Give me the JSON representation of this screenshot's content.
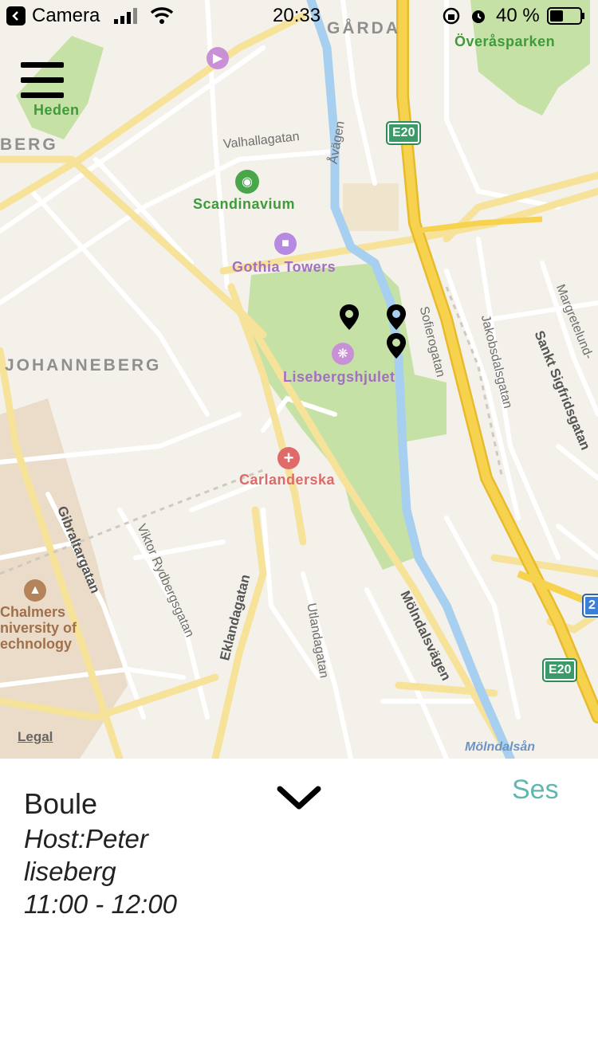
{
  "status_bar": {
    "back_app": "Camera",
    "time": "20:33",
    "battery": "40 %"
  },
  "map": {
    "districts": {
      "heden": "Heden",
      "berg": "BERG",
      "garda": "GÅRDA",
      "johanneberg": "JOHANNEBERG"
    },
    "streets": {
      "valhallagatan": "Valhallagatan",
      "avagen": "Åvägen",
      "sofierogatan": "Sofierogatan",
      "jakobsdalsgatan": "Jakobsdalsgatan",
      "margretelund": "Margretelund-",
      "sankt_sigfridsgatan": "Sankt Sigfridsgatan",
      "gibraltargatan": "Gibraltargatan",
      "viktor_rydbergsgatan": "Viktor Rydbergsgatan",
      "eklandagatan": "Eklandagatan",
      "utlandagatan": "Utlandagatan",
      "molndalsvagen": "Mölndalsvägen"
    },
    "pois": {
      "overasparken": "Överåsparken",
      "scandinavium": "Scandinavium",
      "gothia_towers": "Gothia Towers",
      "lisebergshjulet": "Lisebergshjulet",
      "carlanderska": "Carlanderska",
      "chalmers_1": "Chalmers",
      "chalmers_2": "niversity of",
      "chalmers_3": "echnology"
    },
    "water": {
      "molndalsan": "Mölndalsån"
    },
    "road_shields": [
      "E20",
      "E20",
      "2"
    ],
    "pins": 3,
    "legal": "Legal"
  },
  "sheet": {
    "title": "Boule",
    "host": "Host:Peter",
    "location": "liseberg",
    "time_range": "11:00 - 12:00",
    "action": "Ses"
  },
  "colors": {
    "map_bg": "#f4f1ea",
    "park": "#c5e1a5",
    "highway": "#f5d14d",
    "water": "#a7d0f0",
    "accent": "#62b6b1"
  }
}
